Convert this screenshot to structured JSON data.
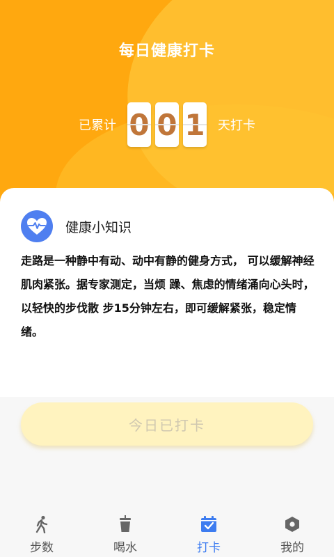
{
  "header": {
    "title": "每日健康打卡",
    "prefix": "已累计",
    "digits": [
      "0",
      "0",
      "1"
    ],
    "suffix": "天打卡"
  },
  "card": {
    "title": "健康小知识",
    "icon": "heart-pulse-icon",
    "body": "走路是一种静中有动、动中有静的健身方式， 可以缓解神经肌肉紧张。据专家测定，当烦 躁、焦虑的情绪涌向心头时，以轻快的步伐散 步15分钟左右，即可缓解紧张，稳定情绪。"
  },
  "check_button": {
    "label": "今日已打卡"
  },
  "tabs": [
    {
      "label": "步数",
      "icon": "walk-icon"
    },
    {
      "label": "喝水",
      "icon": "cup-icon"
    },
    {
      "label": "打卡",
      "icon": "calendar-check-icon",
      "active": true
    },
    {
      "label": "我的",
      "icon": "settings-hex-icon"
    }
  ],
  "colors": {
    "header_bg": "#ffa80f",
    "digit_text": "#c0763a",
    "accent_blue": "#3d7cf0",
    "button_bg": "#fff3bf"
  }
}
